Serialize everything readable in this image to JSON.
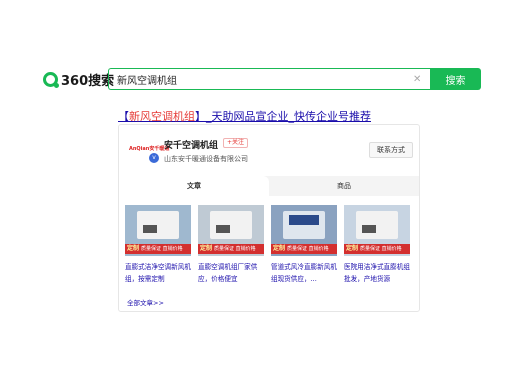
{
  "logo": {
    "text": "360搜索",
    "color": "#19b955"
  },
  "search": {
    "query": "新风空调机组",
    "button_label": "搜索",
    "clear_icon": "close-icon"
  },
  "result": {
    "title_prefix": "【",
    "title_keyword": "新风空调机组",
    "title_suffix": "】_天助网品宣企业_快传企业号推荐",
    "company": {
      "logo_text": "AnQian安千暖通",
      "name": "安千空调机组",
      "follow_label": "+关注",
      "full_name": "山东安千暖通设备有限公司",
      "contact_label": "联系方式"
    },
    "tabs": [
      {
        "label": "文章",
        "active": true
      },
      {
        "label": "商品",
        "active": false
      }
    ],
    "products": [
      {
        "tag": "定制",
        "tag_text": "质量保证 直销价格",
        "desc": "直膨式洁净空调新风机组，按需定制"
      },
      {
        "tag": "定制",
        "tag_text": "质量保证 直销价格",
        "desc": "直膨空调机组厂家供应，价格便宜"
      },
      {
        "tag": "定制",
        "tag_text": "质量保证 直销价格",
        "desc": "管道式风冷直膨新风机组现货供应，..."
      },
      {
        "tag": "定制",
        "tag_text": "质量保证 直销价格",
        "desc": "医院用洁净式直膨机组批发，产地货源"
      }
    ],
    "all_link": "全部文章>>"
  }
}
